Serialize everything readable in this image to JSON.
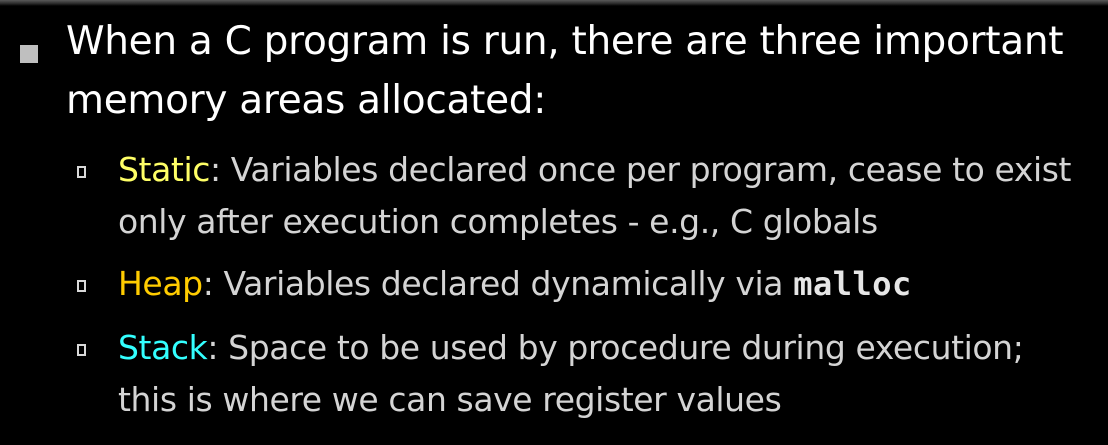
{
  "main_point": {
    "text": "When a C program is run, there are three important memory areas allocated:"
  },
  "sub_points": [
    {
      "term": "Static",
      "rest": ": Variables declared once per program, cease to exist only after execution completes - e.g., C globals",
      "term_color": "#ffff66"
    },
    {
      "term": "Heap",
      "rest": ": Variables declared dynamically via ",
      "code": "malloc",
      "term_color": "#ffcc00"
    },
    {
      "term": "Stack",
      "rest": ": Space to be used by procedure during execution; this is where we can save register values",
      "term_color": "#33ffff"
    }
  ],
  "colors": {
    "background": "#000000",
    "main_text": "#ffffff",
    "sub_text": "#d4d4d4"
  }
}
